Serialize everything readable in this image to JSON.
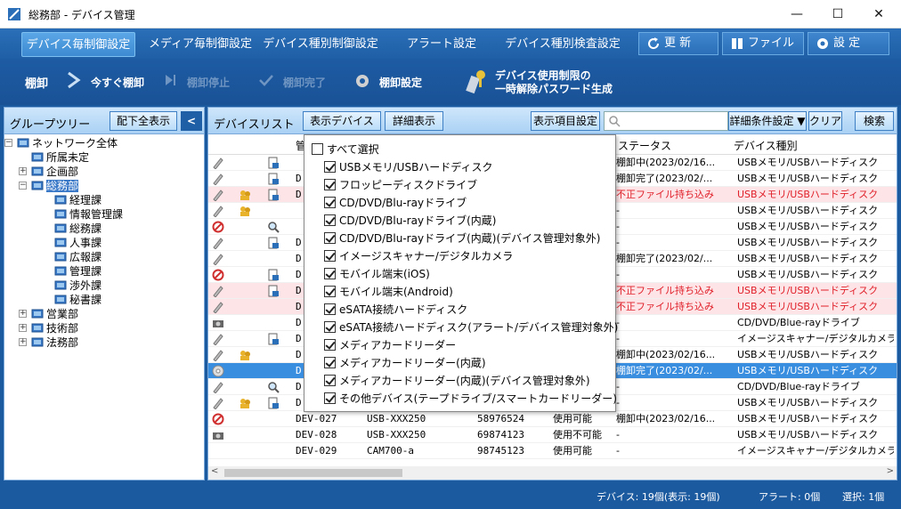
{
  "window": {
    "title": "総務部 - デバイス管理",
    "minimize": "—",
    "maximize": "☐",
    "close": "✕"
  },
  "tabs": [
    {
      "label": "デバイス毎制御設定",
      "active": true
    },
    {
      "label": "メディア毎制御設定"
    },
    {
      "label": "デバイス種別制御設定"
    },
    {
      "label": "アラート設定"
    },
    {
      "label": "デバイス種別検査設定"
    }
  ],
  "toolbar": {
    "refresh": "更 新",
    "file": "ファイル",
    "settings": "設 定"
  },
  "actions": {
    "section": "棚卸",
    "now": "今すぐ棚卸",
    "stop": "棚卸停止",
    "complete": "棚卸完了",
    "config": "棚卸設定",
    "unlock_line1": "デバイス使用制限の",
    "unlock_line2": "一時解除パスワード生成"
  },
  "left_panel": {
    "title": "グループツリー",
    "expand_all": "配下全表示",
    "collapse": "<",
    "tree": [
      {
        "label": "ネットワーク全体",
        "level": 0,
        "exp": "−"
      },
      {
        "label": "所属未定",
        "level": 1
      },
      {
        "label": "企画部",
        "level": 1,
        "exp": "+"
      },
      {
        "label": "総務部",
        "level": 1,
        "exp": "−",
        "selected": true
      },
      {
        "label": "経理課",
        "level": 2
      },
      {
        "label": "情報管理課",
        "level": 2
      },
      {
        "label": "総務課",
        "level": 2
      },
      {
        "label": "人事課",
        "level": 2
      },
      {
        "label": "広報課",
        "level": 2
      },
      {
        "label": "管理課",
        "level": 2
      },
      {
        "label": "渉外課",
        "level": 2
      },
      {
        "label": "秘書課",
        "level": 2
      },
      {
        "label": "営業部",
        "level": 1,
        "exp": "+"
      },
      {
        "label": "技術部",
        "level": 1,
        "exp": "+"
      },
      {
        "label": "法務部",
        "level": 1,
        "exp": "+"
      }
    ]
  },
  "right_panel": {
    "title": "デバイスリスト",
    "show_devices": "表示デバイス",
    "detail": "詳細表示",
    "columns_btn": "表示項目設定",
    "search_placeholder": "",
    "advanced": "詳細条件設定 ▼",
    "clear": "クリア",
    "search": "検索"
  },
  "columns": {
    "mgmt": "管",
    "status": "ステータス",
    "type": "デバイス種別"
  },
  "rows": [
    {
      "icons": [
        "pencil",
        "",
        "lockdoc"
      ],
      "name": "",
      "model": "",
      "serial": "",
      "use": "",
      "status": "棚卸中(2023/02/16...",
      "type": "USBメモリ/USBハードディスク"
    },
    {
      "icons": [
        "pencil",
        "",
        "lockdoc"
      ],
      "name": "D",
      "model": "",
      "serial": "",
      "use": "",
      "status": "棚卸完了(2023/02/...",
      "type": "USBメモリ/USBハードディスク"
    },
    {
      "icons": [
        "pencil",
        "people",
        "lockdoc"
      ],
      "name": "D",
      "model": "",
      "serial": "",
      "use": "",
      "status": "不正ファイル持ち込み",
      "type": "USBメモリ/USBハードディスク",
      "red": true
    },
    {
      "icons": [
        "pencil",
        "people",
        ""
      ],
      "name": "",
      "model": "",
      "serial": "",
      "use": "",
      "status": "-",
      "type": "USBメモリ/USBハードディスク"
    },
    {
      "icons": [
        "block",
        "",
        "magnify"
      ],
      "name": "",
      "model": "",
      "serial": "",
      "use": "",
      "status": "-",
      "type": "USBメモリ/USBハードディスク"
    },
    {
      "icons": [
        "pencil",
        "",
        "lockdoc"
      ],
      "name": "D",
      "model": "",
      "serial": "",
      "use": "",
      "status": "-",
      "type": "USBメモリ/USBハードディスク"
    },
    {
      "icons": [
        "pencil",
        "",
        ""
      ],
      "name": "D",
      "model": "",
      "serial": "",
      "use": "",
      "status": "棚卸完了(2023/02/...",
      "type": "USBメモリ/USBハードディスク"
    },
    {
      "icons": [
        "block",
        "",
        "lockdoc"
      ],
      "name": "D",
      "model": "",
      "serial": "",
      "use": "",
      "status": "-",
      "type": "USBメモリ/USBハードディスク"
    },
    {
      "icons": [
        "pencil",
        "",
        "lockdoc"
      ],
      "name": "D",
      "model": "",
      "serial": "",
      "use": "",
      "status": "不正ファイル持ち込み",
      "type": "USBメモリ/USBハードディスク",
      "red": true
    },
    {
      "icons": [
        "pencil",
        "",
        ""
      ],
      "name": "D",
      "model": "",
      "serial": "",
      "use": "",
      "status": "不正ファイル持ち込み",
      "type": "USBメモリ/USBハードディスク",
      "red": true
    },
    {
      "icons": [
        "camera",
        "",
        ""
      ],
      "name": "D",
      "model": "",
      "serial": "",
      "use": "",
      "status": "-",
      "type": "CD/DVD/Blue-rayドライブ"
    },
    {
      "icons": [
        "pencil",
        "",
        "lockdoc"
      ],
      "name": "D",
      "model": "",
      "serial": "",
      "use": "",
      "status": "-",
      "type": "イメージスキャナー/デジタルカメラ"
    },
    {
      "icons": [
        "pencil",
        "people",
        ""
      ],
      "name": "D",
      "model": "",
      "serial": "",
      "use": "",
      "status": "棚卸中(2023/02/16...",
      "type": "USBメモリ/USBハードディスク"
    },
    {
      "icons": [
        "disc",
        "",
        ""
      ],
      "name": "D",
      "model": "",
      "serial": "",
      "use": "",
      "status": "棚卸完了(2023/02/...",
      "type": "USBメモリ/USBハードディスク",
      "selected": true
    },
    {
      "icons": [
        "pencil",
        "",
        "magnify"
      ],
      "name": "D",
      "model": "",
      "serial": "",
      "use": "",
      "status": "-",
      "type": "CD/DVD/Blue-rayドライブ"
    },
    {
      "icons": [
        "pencil",
        "people",
        "lockdoc"
      ],
      "name": "D",
      "model": "",
      "serial": "",
      "use": "",
      "status": "-",
      "type": "USBメモリ/USBハードディスク"
    },
    {
      "icons": [
        "block",
        "",
        ""
      ],
      "name": "DEV-027",
      "model": "USB-XXX250",
      "serial": "58976524",
      "use": "使用可能",
      "status": "棚卸中(2023/02/16...",
      "type": "USBメモリ/USBハードディスク"
    },
    {
      "icons": [
        "camera",
        "",
        ""
      ],
      "name": "DEV-028",
      "model": "USB-XXX250",
      "serial": "69874123",
      "use": "使用不可能",
      "status": "-",
      "type": "USBメモリ/USBハードディスク"
    },
    {
      "icons": [
        "",
        "",
        ""
      ],
      "name": "DEV-029",
      "model": "CAM700-a",
      "serial": "98745123",
      "use": "使用可能",
      "status": "-",
      "type": "イメージスキャナー/デジタルカメラ"
    }
  ],
  "dropdown": {
    "select_all": "すべて選択",
    "items": [
      "USBメモリ/USBハードディスク",
      "フロッピーディスクドライブ",
      "CD/DVD/Blu-rayドライブ",
      "CD/DVD/Blu-rayドライブ(内蔵)",
      "CD/DVD/Blu-rayドライブ(内蔵)(デバイス管理対象外)",
      "イメージスキャナー/デジタルカメラ",
      "モバイル端末(iOS)",
      "モバイル端末(Android)",
      "eSATA接続ハードディスク",
      "eSATA接続ハードディスク(アラート/デバイス管理対象外)",
      "メディアカードリーダー",
      "メディアカードリーダー(内蔵)",
      "メディアカードリーダー(内蔵)(デバイス管理対象外)",
      "その他デバイス(テープドライブ/スマートカードリーダー)"
    ]
  },
  "status": {
    "devices": "デバイス:  19個(表示: 19個)",
    "alerts": "アラート:  0個",
    "selected": "選択:  1個"
  },
  "colors": {
    "accent": "#1c5aa0",
    "selected_row": "#3a8ee0",
    "alert_row": "#fde4e6",
    "alert_text": "#e0202a"
  }
}
